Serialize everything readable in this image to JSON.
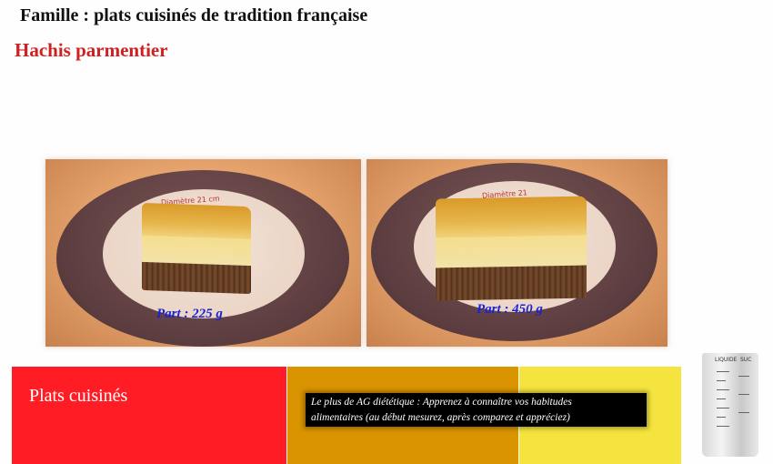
{
  "header": {
    "family_title": "Famille : plats cuisinés de tradition française",
    "dish_title": "Hachis parmentier"
  },
  "photos": [
    {
      "plate_text": "Diamètre 21 cm",
      "portion_label": "Part : 225 g"
    },
    {
      "plate_text": "Diamètre 21",
      "portion_label": "Part : 450 g"
    }
  ],
  "footer": {
    "category_label": "Plats cuisinés",
    "tip_line1": "Le plus de AG diététique : Apprenez à connaître vos habitudes",
    "tip_line2": "alimentaires (au début mesurez, après comparez et appréciez)"
  },
  "measuring_cup": {
    "label_left": "LIQUIDE",
    "label_right": "SUC"
  },
  "colors": {
    "title_red": "#cc2222",
    "portion_blue": "#1a22d6",
    "band_red": "#ff1c24",
    "band_orange": "#d99400",
    "band_yellow": "#f5e43d"
  }
}
